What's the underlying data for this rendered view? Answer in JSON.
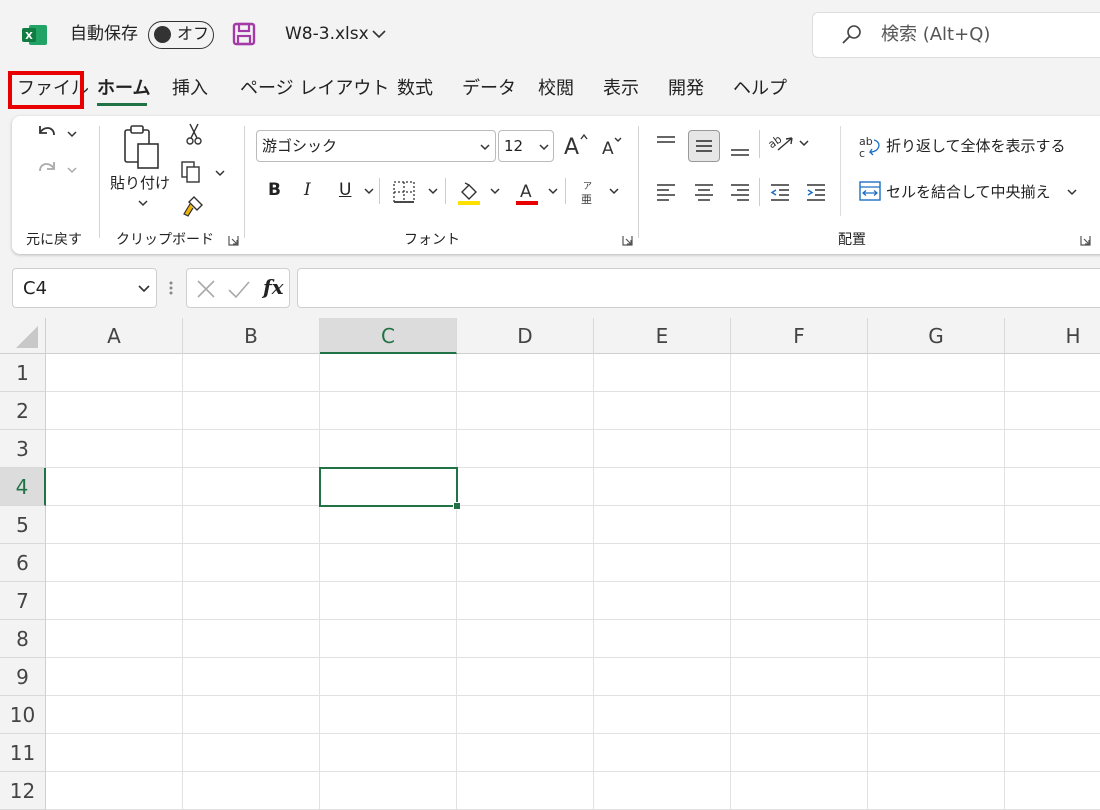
{
  "titlebar": {
    "autosave_label": "自動保存",
    "autosave_state": "オフ",
    "file_name": "W8-3.xlsx",
    "search_placeholder": "検索 (Alt+Q)"
  },
  "tabs": [
    {
      "label": "ファイル"
    },
    {
      "label": "ホーム"
    },
    {
      "label": "挿入"
    },
    {
      "label": "ページ レイアウト"
    },
    {
      "label": "数式"
    },
    {
      "label": "データ"
    },
    {
      "label": "校閲"
    },
    {
      "label": "表示"
    },
    {
      "label": "開発"
    },
    {
      "label": "ヘルプ"
    }
  ],
  "ribbon": {
    "groups": {
      "undo": "元に戻す",
      "clipboard": "クリップボード",
      "font": "フォント",
      "alignment": "配置"
    },
    "paste_label": "貼り付け",
    "font_name": "游ゴシック",
    "font_size": "12",
    "bold": "B",
    "italic": "I",
    "underline": "U",
    "wrap_text": "折り返して全体を表示する",
    "merge_center": "セルを結合して中央揃え"
  },
  "formula_bar": {
    "name_box": "C4",
    "fx": "fx",
    "value": ""
  },
  "sheet": {
    "columns": [
      "A",
      "B",
      "C",
      "D",
      "E",
      "F",
      "G",
      "H"
    ],
    "rows": [
      "1",
      "2",
      "3",
      "4",
      "5",
      "6",
      "7",
      "8",
      "9",
      "10",
      "11",
      "12"
    ],
    "active_cell": "C4"
  },
  "colors": {
    "accent": "#217346",
    "highlight_box": "#e80000",
    "fill_color": "#ffe000",
    "font_color": "#e80000",
    "save_icon": "#a33aa8"
  }
}
